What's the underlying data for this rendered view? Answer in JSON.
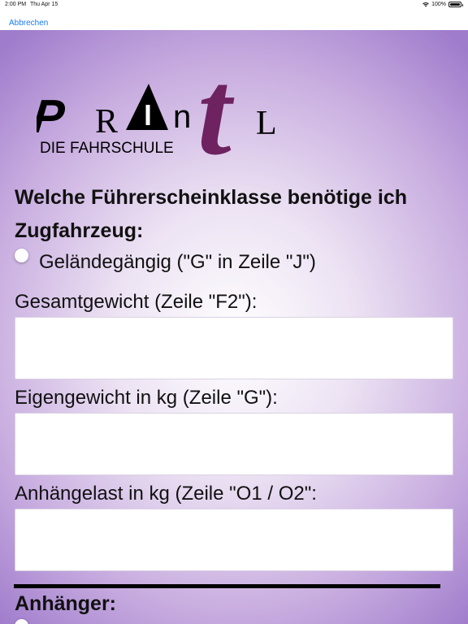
{
  "status_bar": {
    "time": "2:00 PM",
    "date": "Thu Apr 15",
    "battery": "100%",
    "battery_level": 1.0,
    "wifi_icon": "wifi-icon",
    "battery_icon": "battery-icon"
  },
  "nav": {
    "cancel_label": "Abbrechen"
  },
  "logo": {
    "letters": [
      "P",
      "R",
      "A",
      "n",
      "t",
      "L"
    ],
    "subtitle": "DIE FAHRSCHULE",
    "accent_color": "#6e2260"
  },
  "form": {
    "heading": "Welche Führerscheinklasse benötige ich",
    "subheading": "Zugfahrzeug:",
    "radio_gelaende": {
      "label": "Geländegängig (\"G\" in Zeile \"J\")",
      "checked": false
    },
    "fields": [
      {
        "label": "Gesamtgewicht (Zeile \"F2\"):",
        "value": "",
        "placeholder": ""
      },
      {
        "label": "Eigengewicht in kg (Zeile \"G\"):",
        "value": "",
        "placeholder": ""
      },
      {
        "label": "Anhängelast in kg (Zeile \"O1 / O2\":",
        "value": "",
        "placeholder": ""
      }
    ],
    "section_trailer": "Anhänger:"
  },
  "colors": {
    "link": "#1a7cf0",
    "background_edge": "#a07ccc",
    "background_center": "#ffffff"
  }
}
